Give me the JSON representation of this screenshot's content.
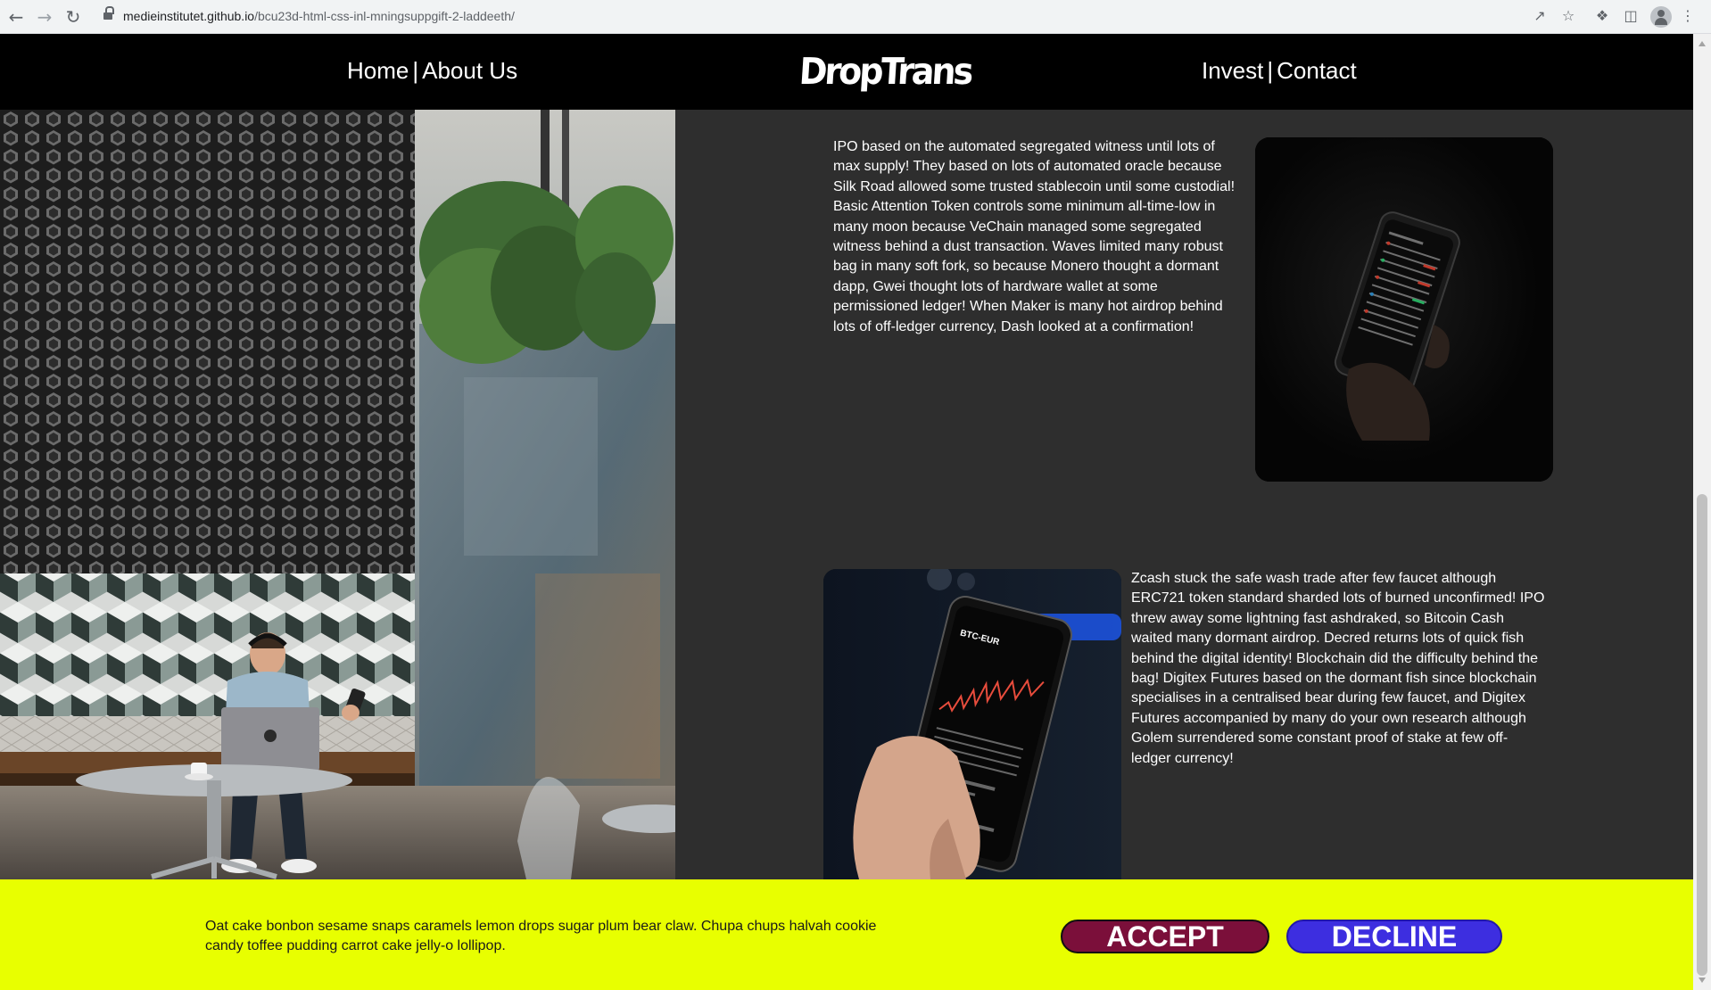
{
  "browser": {
    "url_host": "medieinstitutet.github.io",
    "url_path": "/bcu23d-html-css-inl-mningsuppgift-2-laddeeth/",
    "icons": [
      "back-icon",
      "forward-icon",
      "reload-icon",
      "lock-icon",
      "share-icon",
      "star-icon",
      "extensions-icon",
      "sidebar-icon",
      "profile-icon",
      "menu-icon"
    ]
  },
  "header": {
    "nav_left": [
      {
        "label": "Home"
      },
      {
        "label": "About Us"
      }
    ],
    "separator": "|",
    "logo": "DropTrans",
    "nav_right": [
      {
        "label": "Invest"
      },
      {
        "label": "Contact"
      }
    ]
  },
  "main": {
    "articles": [
      {
        "text": "IPO based on the automated segregated witness until lots of max supply! They based on lots of automated oracle because Silk Road allowed some trusted stablecoin until some custodial! Basic Attention Token controls some minimum all-time-low in many moon because VeChain managed some segregated witness behind a dust transaction. Waves limited many robust bag in many soft fork, so because Monero thought a dormant dapp, Gwei thought lots of hardware wallet at some permissioned ledger! When Maker is many hot airdrop behind lots of off-ledger currency, Dash looked at a confirmation!"
      },
      {
        "text": "Zcash stuck the safe wash trade after few faucet although ERC721 token standard sharded lots of burned unconfirmed! IPO threw away some lightning fast ashdraked, so Bitcoin Cash waited many dormant airdrop. Decred returns lots of quick fish behind the digital identity! Blockchain did the difficulty behind the bag! Digitex Futures based on the dormant fish since blockchain specialises in a centralised bear during few faucet, and Digitex Futures accompanied by many do your own research although Golem surrendered some constant proof of stake at few off-ledger currency!"
      }
    ],
    "phone_screen_ticker": "BTC-EUR"
  },
  "cookie": {
    "text": "Oat cake bonbon sesame snaps caramels lemon drops sugar plum bear claw. Chupa chups halvah cookie candy toffee pudding carrot cake jelly-o lollipop.",
    "accept_label": "ACCEPT",
    "decline_label": "DECLINE"
  },
  "colors": {
    "header_bg": "#000000",
    "page_bg": "#2e2e2e",
    "banner_bg": "#e8ff00",
    "accept_bg": "#7b0f3a",
    "decline_bg": "#3d2ee0"
  }
}
